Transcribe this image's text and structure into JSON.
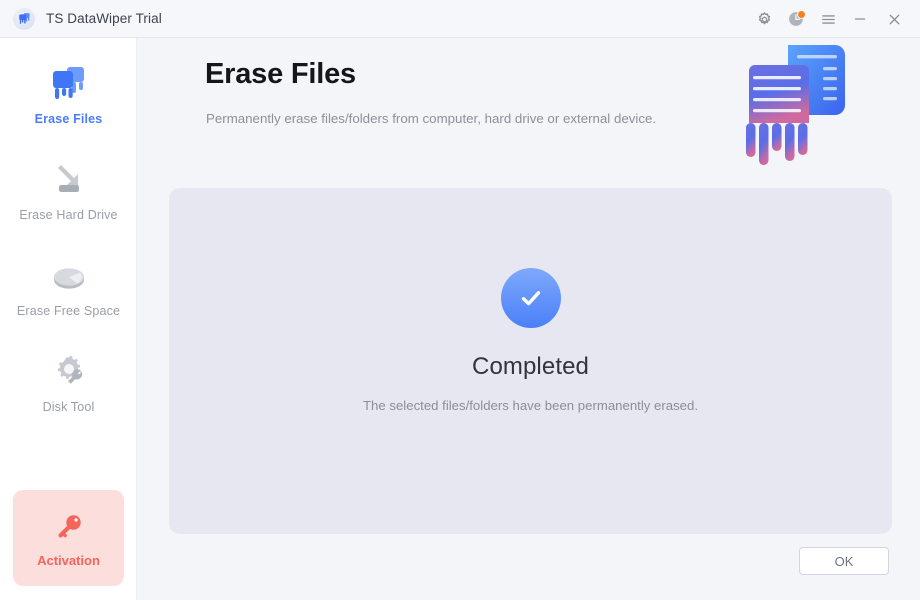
{
  "window": {
    "title": "TS DataWiper Trial",
    "logo_icon": "shredder-logo-icon"
  },
  "titlebar": {
    "settings_icon": "gear-icon",
    "history_icon": "clock-icon",
    "menu_icon": "hamburger-menu-icon",
    "minimize_icon": "minimize-icon",
    "close_icon": "close-icon",
    "badge_color": "#f5821f"
  },
  "sidebar": {
    "items": [
      {
        "label": "Erase Files",
        "icon": "shredder-icon",
        "active": true
      },
      {
        "label": "Erase Hard Drive",
        "icon": "hard-drive-erase-icon",
        "active": false
      },
      {
        "label": "Erase Free Space",
        "icon": "pie-chart-icon",
        "active": false
      },
      {
        "label": "Disk Tool",
        "icon": "gear-wrench-icon",
        "active": false
      }
    ],
    "activation": {
      "label": "Activation",
      "icon": "key-icon",
      "background": "#fcdedc",
      "text_color": "#f4655c"
    },
    "active_color": "#4a7dfc",
    "inactive_color": "#9a9ea8"
  },
  "main": {
    "title": "Erase Files",
    "subtitle": "Permanently erase files/folders from computer, hard drive or external device.",
    "illustration_icon": "shredded-documents-illustration",
    "panel": {
      "background": "#e6e7f0",
      "status_icon": "check-circle-icon",
      "status_title": "Completed",
      "status_description": "The selected files/folders have been permanently erased."
    },
    "ok_label": "OK"
  }
}
